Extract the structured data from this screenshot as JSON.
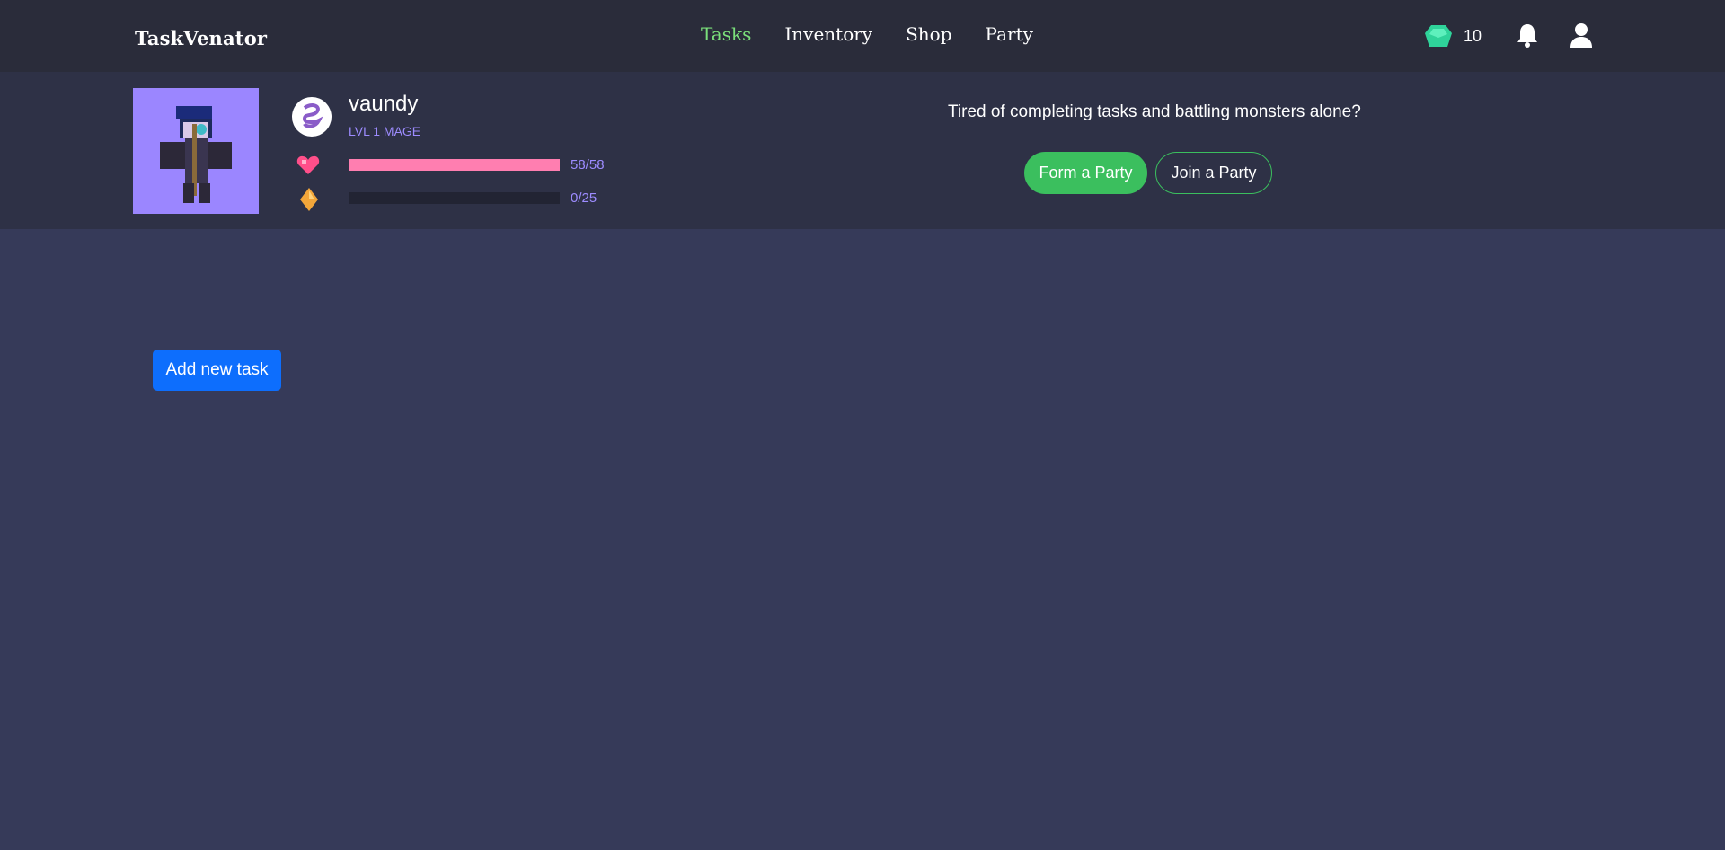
{
  "app": {
    "brand": "TaskVenator"
  },
  "nav": {
    "links": [
      {
        "label": "Tasks",
        "active": true
      },
      {
        "label": "Inventory",
        "active": false
      },
      {
        "label": "Shop",
        "active": false
      },
      {
        "label": "Party",
        "active": false
      }
    ],
    "gem_count": "10",
    "icons": [
      "gem-icon",
      "bell-icon",
      "user-icon"
    ]
  },
  "player": {
    "username": "vaundy",
    "level_label": "LVL 1 MAGE",
    "class_icon": "mage-swirl-icon",
    "hp": {
      "label": "58/58",
      "fraction": 1.0,
      "color": "#ff7eb0"
    },
    "xp": {
      "label": "0/25",
      "fraction": 0.0,
      "color": "#f2a63a"
    }
  },
  "party": {
    "prompt": "Tired of completing tasks and battling monsters alone?",
    "form_label": "Form a Party",
    "join_label": "Join a Party"
  },
  "tasks": {
    "add_label": "Add new task"
  },
  "colors": {
    "active_nav": "#7be07b",
    "accent_green": "#3bbf5e",
    "primary_blue": "#0d6efd",
    "level_purple": "#9d8cff"
  }
}
